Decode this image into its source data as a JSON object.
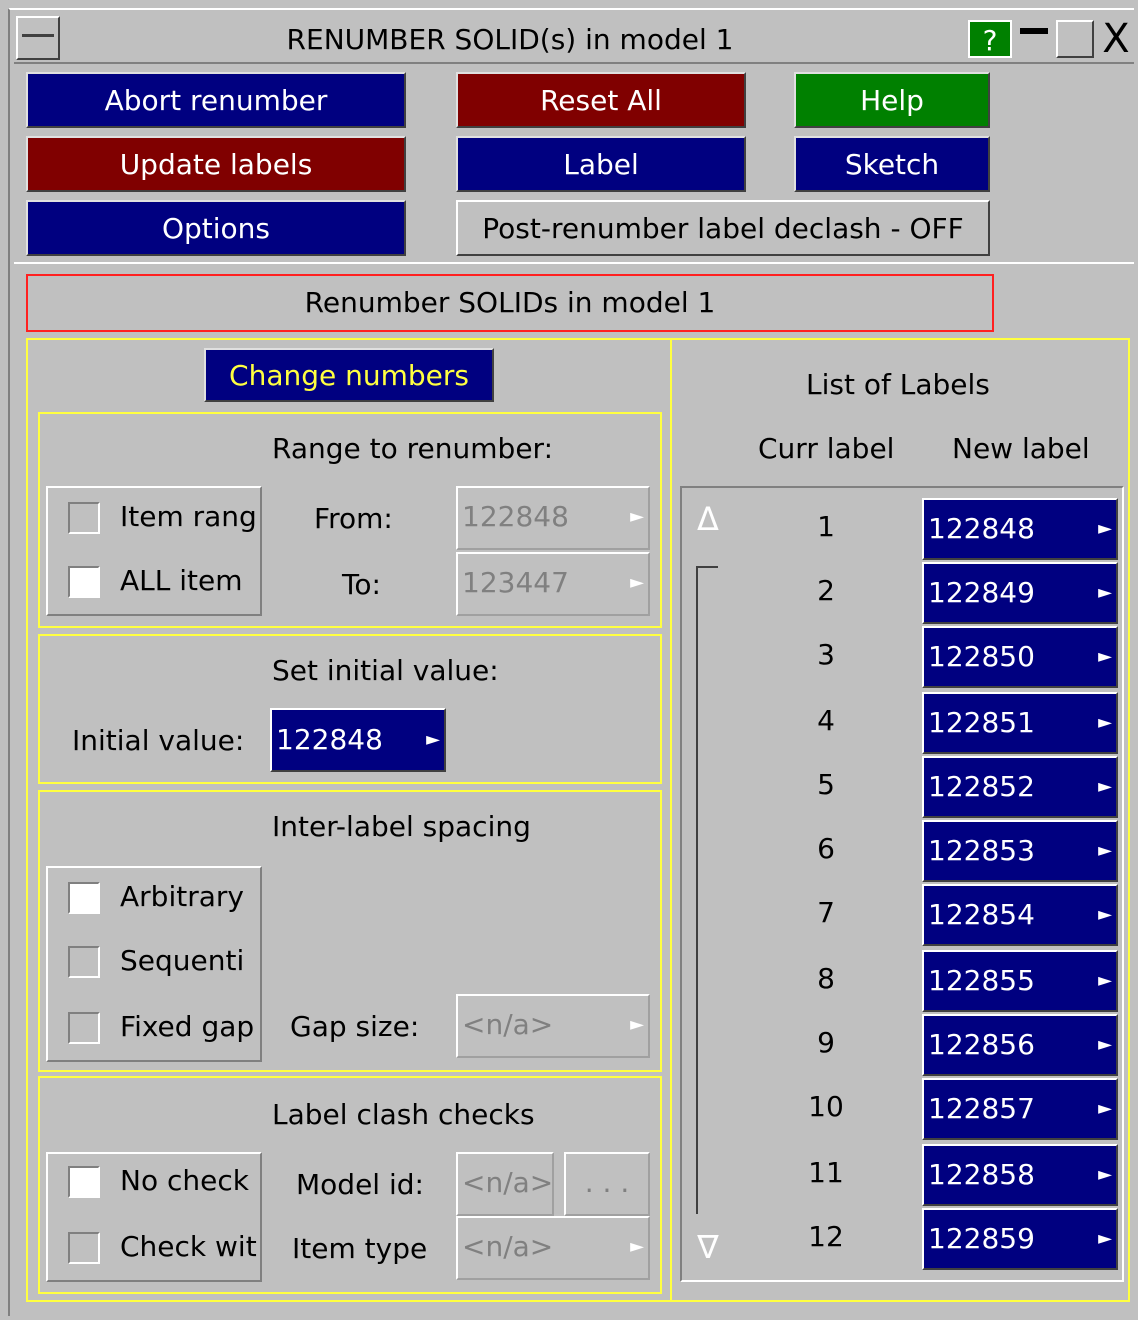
{
  "window": {
    "title": "RENUMBER SOLID(s) in model 1",
    "help_label": "?"
  },
  "toolbar": {
    "abort": "Abort renumber",
    "reset_all": "Reset All",
    "help": "Help",
    "update_labels": "Update labels",
    "label": "Label",
    "sketch": "Sketch",
    "options": "Options",
    "declash": "Post-renumber label declash - OFF"
  },
  "heading": "Renumber SOLIDs in model 1",
  "change_numbers": "Change numbers",
  "range": {
    "title": "Range to renumber:",
    "opt_item": "Item rang",
    "opt_all": "ALL item",
    "from_label": "From:",
    "to_label": "To:",
    "from_value": "122848",
    "to_value": "123447"
  },
  "initial": {
    "title": "Set initial value:",
    "label": "Initial value:",
    "value": "122848"
  },
  "spacing": {
    "title": "Inter-label spacing",
    "opt_arbitrary": "Arbitrary",
    "opt_sequential": "Sequenti",
    "opt_fixed": "Fixed gap",
    "gap_label": "Gap size:",
    "gap_value": "<n/a>"
  },
  "clash": {
    "title": "Label clash checks",
    "opt_no_check": "No check",
    "opt_check_with": "Check wit",
    "model_label": "Model id:",
    "model_value": "<n/a>",
    "model_more": ". . .",
    "type_label": "Item type",
    "type_value": "<n/a>"
  },
  "list": {
    "title": "List of Labels",
    "col_curr": "Curr label",
    "col_new": "New label",
    "rows": [
      {
        "curr": "1",
        "new": "122848"
      },
      {
        "curr": "2",
        "new": "122849"
      },
      {
        "curr": "3",
        "new": "122850"
      },
      {
        "curr": "4",
        "new": "122851"
      },
      {
        "curr": "5",
        "new": "122852"
      },
      {
        "curr": "6",
        "new": "122853"
      },
      {
        "curr": "7",
        "new": "122854"
      },
      {
        "curr": "8",
        "new": "122855"
      },
      {
        "curr": "9",
        "new": "122856"
      },
      {
        "curr": "10",
        "new": "122857"
      },
      {
        "curr": "11",
        "new": "122858"
      },
      {
        "curr": "12",
        "new": "122859"
      }
    ]
  },
  "icons": {
    "arrow": "►",
    "scroll_up": "Δ",
    "scroll_down": "∇",
    "close": "X"
  }
}
